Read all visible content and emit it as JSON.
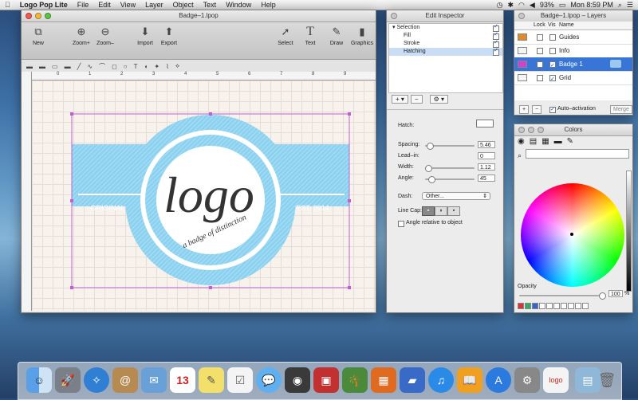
{
  "menubar": {
    "apple": "",
    "app_name": "Logo Pop Lite",
    "items": [
      "File",
      "Edit",
      "View",
      "Layer",
      "Object",
      "Text",
      "Window",
      "Help"
    ],
    "battery": "93%",
    "clock": "Mon 8:59 PM"
  },
  "main_window": {
    "title": "Badge–1.lpop",
    "toolbar": {
      "new": "New",
      "zoom_in": "Zoom+",
      "zoom_out": "Zoom–",
      "import": "Import",
      "export": "Export",
      "select": "Select",
      "text": "Text",
      "draw": "Draw",
      "graphics": "Graphics"
    },
    "ruler_numbers": [
      "0",
      "1",
      "2",
      "3",
      "4",
      "5",
      "6",
      "7",
      "8",
      "9"
    ],
    "logo": {
      "main": "logo",
      "tagline": "a badge of distinction",
      "left": "ORIGINAL",
      "right": "EST. 2014",
      "color": "#8cd2f0",
      "script_color": "#333333"
    }
  },
  "inspector": {
    "title": "Edit Inspector",
    "tree": [
      {
        "label": "Selection",
        "checked": true
      },
      {
        "label": "Fill",
        "checked": true
      },
      {
        "label": "Stroke",
        "checked": true
      },
      {
        "label": "Hatching",
        "checked": true
      }
    ],
    "hatch_label": "Hatch:",
    "spacing_label": "Spacing:",
    "spacing_value": "5.46",
    "leadin_label": "Lead–in:",
    "leadin_value": "0",
    "width_label": "Width:",
    "width_value": "1.12",
    "angle_label": "Angle:",
    "angle_value": "45",
    "dash_label": "Dash:",
    "dash_value": "Other...",
    "linecap_label": "Line Cap:",
    "angle_relative_label": "Angle relative to object"
  },
  "layers": {
    "title": "Badge–1.lpop – Layers",
    "headers": {
      "lock": "Lock",
      "vis": "Vis",
      "name": "Name"
    },
    "rows": [
      {
        "name": "Guides",
        "color": "#e08a2a",
        "visible": false
      },
      {
        "name": "Info",
        "color": "#f4f4f4",
        "visible": false
      },
      {
        "name": "Badge 1",
        "color": "#cc44cc",
        "visible": true
      },
      {
        "name": "Grid",
        "color": "#f4f4f4",
        "visible": true
      }
    ],
    "auto_activation": "Auto–activation",
    "merge": "Merge"
  },
  "colors": {
    "title": "Colors",
    "opacity_label": "Opacity",
    "opacity_value": "100",
    "percent": "%"
  },
  "dock": {
    "items": [
      "finder-icon",
      "launchpad-icon",
      "safari-icon",
      "contacts-icon",
      "mail-icon",
      "calendar-icon",
      "notes-icon",
      "reminders-icon",
      "messages-icon",
      "facetime-icon",
      "photo-booth-icon",
      "iphoto-icon",
      "itunes-icon",
      "app-store-icon",
      "preferences-icon",
      "logo-pop-icon",
      "downloads-icon",
      "trash-icon"
    ],
    "calendar_day": "13"
  }
}
